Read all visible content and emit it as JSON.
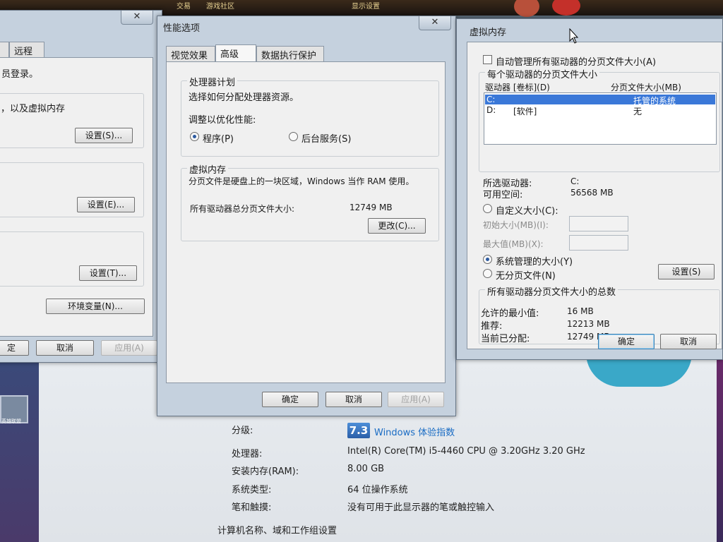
{
  "desktop": {
    "top_items": [
      "交易",
      "游戏社区",
      "显示设置"
    ],
    "side_icon_label": "英雄联盟"
  },
  "system_info": {
    "rating_label": "分级:",
    "rating_value": "7.3",
    "rating_link": "Windows 体验指数",
    "cpu_label": "处理器:",
    "cpu_value": "Intel(R) Core(TM) i5-4460  CPU @ 3.20GHz   3.20 GHz",
    "ram_label": "安装内存(RAM):",
    "ram_value": "8.00 GB",
    "type_label": "系统类型:",
    "type_value": "64 位操作系统",
    "pen_label": "笔和触摸:",
    "pen_value": "没有可用于此显示器的笔或触控输入",
    "section_title": "计算机名称、域和工作组设置"
  },
  "sysprops": {
    "tab_remote": "远程",
    "text_login": "员登录。",
    "text_vm": "，以及虚拟内存",
    "btn_settings_1": "设置(S)...",
    "btn_settings_2": "设置(E)...",
    "btn_settings_3": "设置(T)...",
    "btn_env": "环境变量(N)...",
    "btn_ok": "定",
    "btn_cancel": "取消",
    "btn_apply": "应用(A)"
  },
  "perf": {
    "title": "性能选项",
    "tabs": [
      "视觉效果",
      "高级",
      "数据执行保护"
    ],
    "proc_group": "处理器计划",
    "proc_desc": "选择如何分配处理器资源。",
    "adjust_label": "调整以优化性能:",
    "radio_programs": "程序(P)",
    "radio_services": "后台服务(S)",
    "vm_group": "虚拟内存",
    "vm_desc": "分页文件是硬盘上的一块区域，Windows 当作 RAM 使用。",
    "vm_total_label": "所有驱动器总分页文件大小:",
    "vm_total_value": "12749 MB",
    "btn_change": "更改(C)...",
    "btn_ok": "确定",
    "btn_cancel": "取消",
    "btn_apply": "应用(A)"
  },
  "vm": {
    "title": "虚拟内存",
    "auto_manage": "自动管理所有驱动器的分页文件大小(A)",
    "per_drive_group": "每个驱动器的分页文件大小",
    "col_drive": "驱动器 [卷标](D)",
    "col_size": "分页文件大小(MB)",
    "drives": [
      {
        "drive": "C:",
        "label": "",
        "size": "托管的系统"
      },
      {
        "drive": "D:",
        "label": "[软件]",
        "size": "无"
      }
    ],
    "selected_label": "所选驱动器:",
    "selected_value": "C:",
    "free_label": "可用空间:",
    "free_value": "56568 MB",
    "custom_size": "自定义大小(C):",
    "initial_label": "初始大小(MB)(I):",
    "max_label": "最大值(MB)(X):",
    "system_managed": "系统管理的大小(Y)",
    "no_paging": "无分页文件(N)",
    "btn_set": "设置(S)",
    "total_group": "所有驱动器分页文件大小的总数",
    "min_label": "允许的最小值:",
    "min_value": "16 MB",
    "rec_label": "推荐:",
    "rec_value": "12213 MB",
    "cur_label": "当前已分配:",
    "cur_value": "12749 MB",
    "btn_ok": "确定",
    "btn_cancel": "取消"
  },
  "colors": {
    "selection": "#3a78d8",
    "window_frame": "#c5d1de",
    "link": "#1a6cc4"
  }
}
